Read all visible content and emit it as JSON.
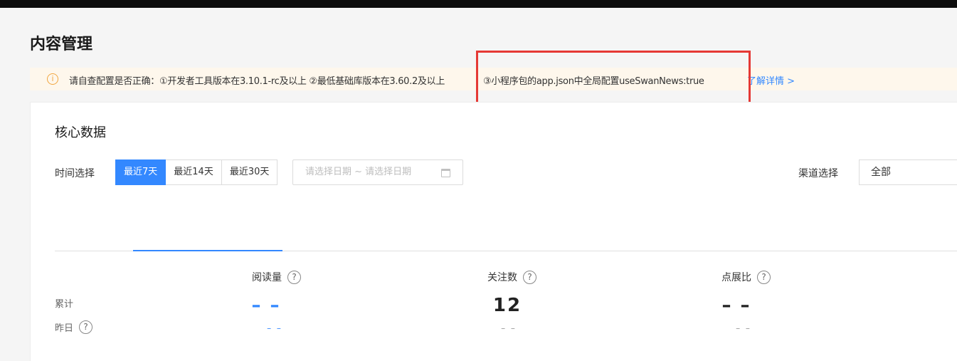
{
  "page": {
    "title": "内容管理"
  },
  "notice": {
    "text_part1": "请自查配置是否正确：①开发者工具版本在3.10.1-rc及以上 ②最低基础库版本在3.60.2及以上",
    "text_part2": "③小程序包的app.json中全局配置useSwanNews:true",
    "learn_more": "了解详情 >",
    "icon": "info-icon"
  },
  "core": {
    "title": "核心数据",
    "time_label": "时间选择",
    "ranges": [
      "最近7天",
      "最近14天",
      "最近30天"
    ],
    "active_range": "最近7天",
    "date_placeholder": "请选择日期 ~ 请选择日期",
    "channel_label": "渠道选择",
    "channel_value": "全部"
  },
  "rows": {
    "total": "累计",
    "yesterday": "昨日"
  },
  "metrics": [
    {
      "name": "阅读量",
      "total": "– –",
      "yesterday": "– –",
      "color": "#3388ff"
    },
    {
      "name": "关注数",
      "total": "12",
      "yesterday": "– –",
      "color": "#222222"
    },
    {
      "name": "点展比",
      "total": "– –",
      "yesterday": "– –",
      "color": "#222222"
    }
  ],
  "colors": {
    "accent": "#3388ff",
    "warning": "#f1a640",
    "highlight": "#e53935"
  }
}
